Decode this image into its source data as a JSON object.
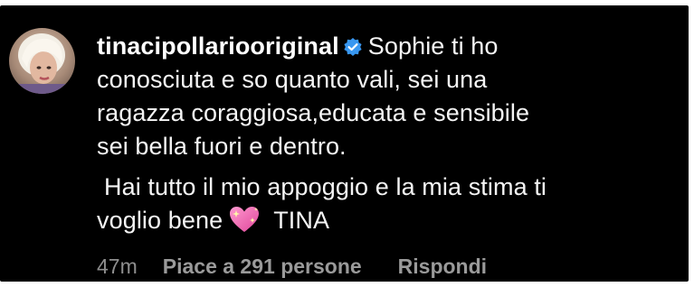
{
  "comment": {
    "username": "tinacipollariooriginal",
    "verified_icon": "verified-badge-icon",
    "text_lines": [
      "Sophie ti ho",
      "conosciuta e so quanto vali, sei una",
      "ragazza coraggiosa,educata e sensibile",
      "sei bella fuori e dentro."
    ],
    "text_para2_line1": "Hai tutto il mio appoggio e la mia stima ti",
    "text_para2_line2": "voglio bene",
    "emoji_icon": "sparkling-heart-icon",
    "signature": "TINA",
    "timestamp": "47m",
    "likes_label": "Piace a 291 persone",
    "reply_label": "Rispondi"
  },
  "colors": {
    "background": "#000000",
    "text": "#f5f5f5",
    "meta": "#8e8e8e",
    "verified": "#3897f0",
    "heart": "#f06bb0"
  }
}
